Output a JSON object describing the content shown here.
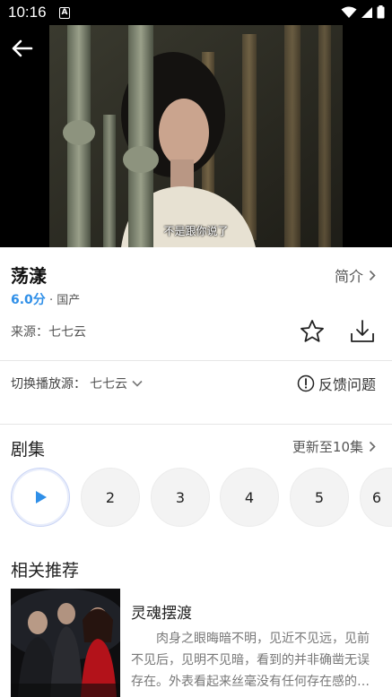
{
  "status_bar": {
    "time": "10:16",
    "notification_glyph": "A"
  },
  "video": {
    "subtitle": "不是跟你说了"
  },
  "show": {
    "title": "荡漾",
    "intro_label": "简介",
    "score": "6.0分",
    "separator": " · ",
    "region": "国产",
    "source_label": "来源：",
    "source_value": "七七云"
  },
  "playback": {
    "switch_label": "切换播放源：",
    "switch_value": "七七云",
    "feedback_label": "反馈问题"
  },
  "episodes": {
    "section_title": "剧集",
    "update_label": "更新至10集",
    "items": [
      "1",
      "2",
      "3",
      "4",
      "5",
      "6"
    ]
  },
  "recommend": {
    "section_title": "相关推荐",
    "items": [
      {
        "name": "灵魂摆渡",
        "description": "肉身之眼晦暗不明，见近不见远，见前不见后，见明不见暗，看到的并非确凿无误存在。外表看起来丝毫没有任何存在感的…"
      }
    ]
  },
  "colors": {
    "accent": "#2f8fe8",
    "play_icon": "#2f8fe8"
  },
  "icons": {
    "back": "arrow-left-icon",
    "star": "star-outline-icon",
    "download": "download-icon",
    "chevron": "chevron-right-icon",
    "dropdown": "chevron-down-icon",
    "feedback": "info-circle-icon",
    "play": "play-icon"
  }
}
